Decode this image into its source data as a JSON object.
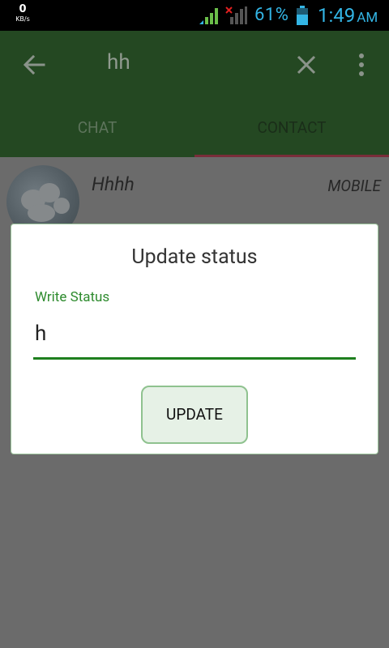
{
  "status_bar": {
    "net_speed_value": "0",
    "net_speed_unit": "KB/s",
    "battery_percent": "61%",
    "battery_level": 0.61,
    "time": "1:49",
    "ampm": "AM",
    "accent_color": "#33b5e5"
  },
  "toolbar": {
    "search_query": "hh",
    "back_icon": "arrow-back-icon",
    "clear_icon": "close-icon",
    "overflow_icon": "more-vert-icon",
    "background_color": "#244822"
  },
  "tabs": [
    {
      "label": "CHAT",
      "selected": false
    },
    {
      "label": "CONTACT",
      "selected": true
    }
  ],
  "contact": {
    "name": "Hhhh",
    "type": "MOBILE"
  },
  "dialog": {
    "title": "Update status",
    "field_label": "Write Status",
    "field_value": "h",
    "button_label": "UPDATE",
    "accent_color": "#1e7f1e"
  }
}
